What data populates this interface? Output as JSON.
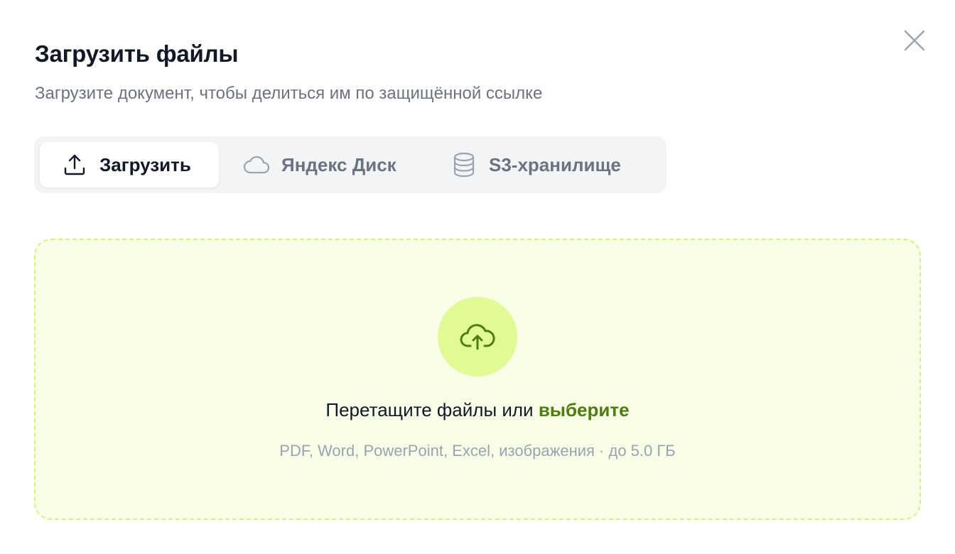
{
  "dialog": {
    "title": "Загрузить файлы",
    "subtitle": "Загрузите документ, чтобы делиться им по защищённой ссылке",
    "close_icon": "close-icon"
  },
  "tabs": [
    {
      "label": "Загрузить",
      "icon": "upload-icon",
      "active": true
    },
    {
      "label": "Яндекс Диск",
      "icon": "cloud-icon",
      "active": false
    },
    {
      "label": "S3-хранилище",
      "icon": "database-icon",
      "active": false
    }
  ],
  "dropzone": {
    "icon": "cloud-upload-icon",
    "prompt_text": "Перетащите файлы или ",
    "prompt_link": "выберите",
    "hint": "PDF, Word, PowerPoint, Excel, изображения · до 5.0 ГБ"
  },
  "colors": {
    "accent": "#4d7c0f",
    "dropzone_bg": "#f9fee7",
    "dropzone_border": "#d6f27a",
    "icon_circle": "#e0fb93"
  }
}
